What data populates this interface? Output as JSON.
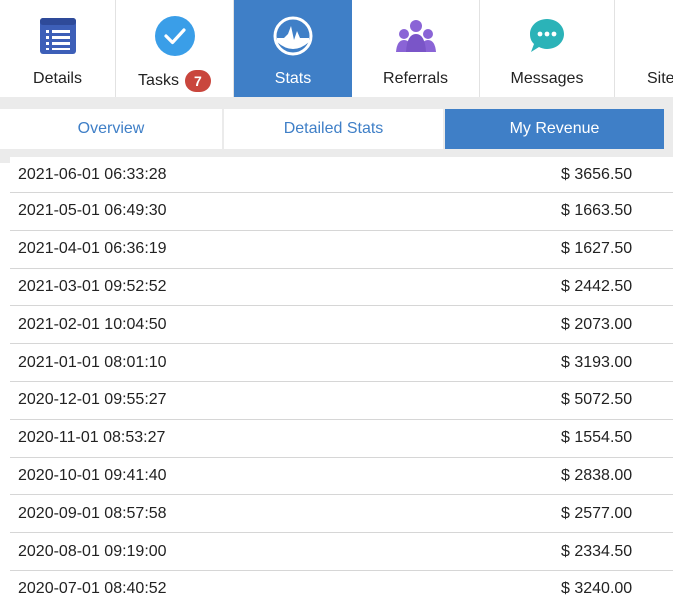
{
  "nav": {
    "items": [
      {
        "label": "Details",
        "icon": "details-list-icon"
      },
      {
        "label": "Tasks",
        "icon": "check-circle-icon",
        "badge": "7"
      },
      {
        "label": "Stats",
        "icon": "stats-wave-icon",
        "active": true
      },
      {
        "label": "Referrals",
        "icon": "people-group-icon"
      },
      {
        "label": "Messages",
        "icon": "chat-bubble-icon"
      },
      {
        "label": "Sites",
        "icon": "sites-icon"
      }
    ]
  },
  "subtabs": {
    "items": [
      {
        "label": "Overview"
      },
      {
        "label": "Detailed Stats"
      },
      {
        "label": "My Revenue",
        "active": true
      }
    ]
  },
  "revenue": {
    "rows": [
      {
        "date": "2021-06-01 06:33:28",
        "amount": "$ 3656.50"
      },
      {
        "date": "2021-05-01 06:49:30",
        "amount": "$ 1663.50"
      },
      {
        "date": "2021-04-01 06:36:19",
        "amount": "$ 1627.50"
      },
      {
        "date": "2021-03-01 09:52:52",
        "amount": "$ 2442.50"
      },
      {
        "date": "2021-02-01 10:04:50",
        "amount": "$ 2073.00"
      },
      {
        "date": "2021-01-01 08:01:10",
        "amount": "$ 3193.00"
      },
      {
        "date": "2020-12-01 09:55:27",
        "amount": "$ 5072.50"
      },
      {
        "date": "2020-11-01 08:53:27",
        "amount": "$ 1554.50"
      },
      {
        "date": "2020-10-01 09:41:40",
        "amount": "$ 2838.00"
      },
      {
        "date": "2020-09-01 08:57:58",
        "amount": "$ 2577.00"
      },
      {
        "date": "2020-08-01 09:19:00",
        "amount": "$ 2334.50"
      },
      {
        "date": "2020-07-01 08:40:52",
        "amount": "$ 3240.00"
      }
    ]
  },
  "colors": {
    "accent": "#3f7fc7",
    "badge": "#c9463d",
    "band": "#ebebeb"
  }
}
